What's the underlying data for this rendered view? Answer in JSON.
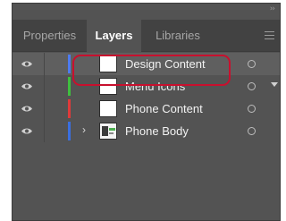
{
  "panel": {
    "tabs": [
      {
        "label": "Properties",
        "active": false
      },
      {
        "label": "Layers",
        "active": true
      },
      {
        "label": "Libraries",
        "active": false
      }
    ],
    "collapse_icon": "double-chevron-right-icon",
    "menu_icon": "hamburger-menu-icon"
  },
  "layers": [
    {
      "name": "Design Content",
      "color": "#4d7bf0",
      "visible": true,
      "selected": true,
      "expandable": false,
      "thumbnail": "blank"
    },
    {
      "name": "Menu Icons",
      "color": "#3fbf3f",
      "visible": true,
      "selected": false,
      "expandable": false,
      "thumbnail": "blank"
    },
    {
      "name": "Phone Content",
      "color": "#e03a3a",
      "visible": true,
      "selected": false,
      "expandable": false,
      "thumbnail": "blank"
    },
    {
      "name": "Phone Body",
      "color": "#3a6fe0",
      "visible": true,
      "selected": false,
      "expandable": true,
      "thumbnail": "artwork"
    }
  ],
  "colors": {
    "highlight": "#c8102e",
    "panel_bg": "#535353",
    "tabbar_bg": "#424242"
  }
}
